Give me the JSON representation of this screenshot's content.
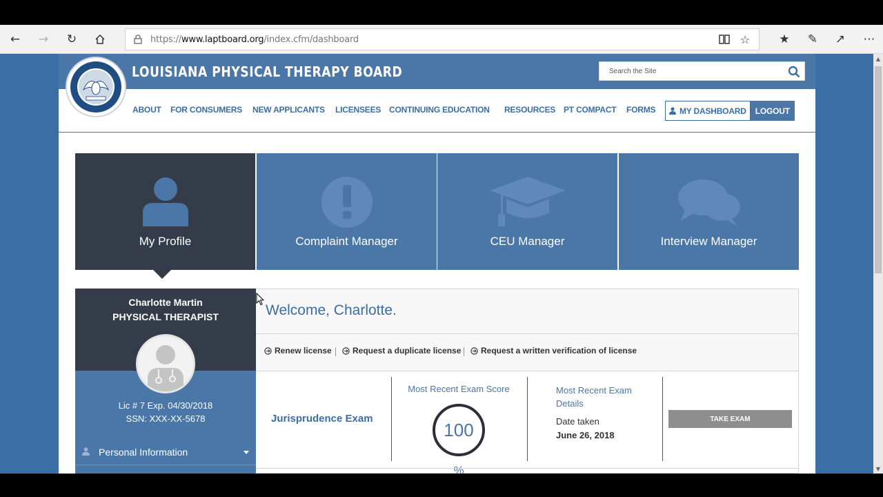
{
  "browser": {
    "url_prefix": "https://",
    "url_domain": "www.laptboard.org",
    "url_path": "/index.cfm/dashboard",
    "icons": [
      "back-icon",
      "forward-icon",
      "refresh-icon",
      "home-icon",
      "lock-icon",
      "reading-view-icon",
      "favorite-star-icon",
      "favorites-icon",
      "notes-pen-icon",
      "share-icon",
      "more-icon"
    ]
  },
  "site": {
    "title": "LOUISIANA PHYSICAL THERAPY BOARD",
    "search_placeholder": "Search the Site",
    "nav": [
      "ABOUT",
      "FOR CONSUMERS",
      "NEW APPLICANTS",
      "LICENSEES",
      "CONTINUING EDUCATION",
      "RESOURCES",
      "PT COMPACT",
      "FORMS"
    ],
    "dashboard_label": "MY DASHBOARD",
    "logout_label": "LOGOUT",
    "colors": {
      "brand_blue": "#4a76a8",
      "dark": "#343c4a",
      "page_bg": "#3a6ea5"
    }
  },
  "tiles": [
    {
      "label": "My Profile",
      "icon": "user-icon",
      "active": true
    },
    {
      "label": "Complaint Manager",
      "icon": "exclamation-icon",
      "active": false
    },
    {
      "label": "CEU Manager",
      "icon": "graduation-cap-icon",
      "active": false
    },
    {
      "label": "Interview Manager",
      "icon": "chat-bubbles-icon",
      "active": false
    }
  ],
  "profile": {
    "name": "Charlotte Martin",
    "title": "PHYSICAL THERAPIST",
    "license": "Lic # 7 Exp. 04/30/2018",
    "ssn": "SSN: XXX-XX-5678",
    "menu_item": "Personal Information"
  },
  "main": {
    "welcome": "Welcome, Charlotte.",
    "actions": [
      "Renew license",
      "Request a duplicate license",
      "Request a written verification of license"
    ],
    "exam": {
      "name": "Jurisprudence Exam",
      "score_label": "Most Recent Exam Score",
      "score": "100",
      "score_unit": "%",
      "details_label": "Most Recent Exam Details",
      "date_label": "Date taken",
      "date_value": "June 26, 2018",
      "button": "TAKE EXAM"
    }
  }
}
